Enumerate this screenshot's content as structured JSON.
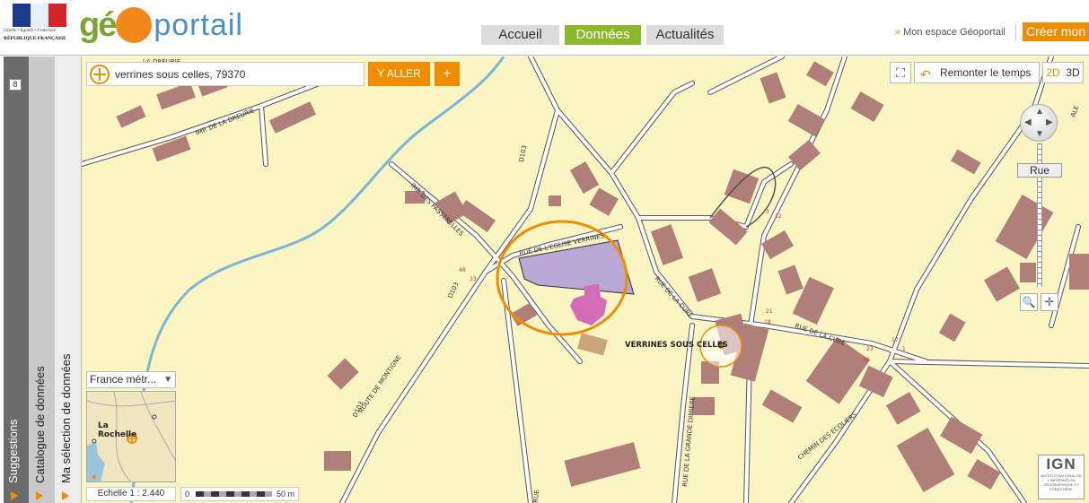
{
  "header": {
    "rf_motto": "Liberté • Égalité • Fraternité",
    "rf_name": "RÉPUBLIQUE FRANÇAISE",
    "logo_ge": "gé",
    "logo_portail": "portail",
    "nav_tabs": [
      {
        "label": "Accueil",
        "active": false
      },
      {
        "label": "Données",
        "active": true
      },
      {
        "label": "Actualités",
        "active": false
      }
    ],
    "espace_label": "Mon espace Géoportail",
    "creer_label": "Créer mon espace",
    "colors": {
      "accent_orange": "#f08c00",
      "active_green": "#8bb92b",
      "brand_blue": "#4a8fc8"
    }
  },
  "side_panels": {
    "count": "8",
    "suggestions": "Suggestions",
    "catalogue": "Catalogue de données",
    "selection": "Ma sélection de données"
  },
  "search": {
    "value": "verrines sous celles, 79370",
    "go_label": "Y ALLER",
    "add_label": "+"
  },
  "tools": {
    "remonter_label": "Remonter le temps",
    "btn_2d": "2D",
    "btn_3d": "3D",
    "zoom_level_label": "Rue"
  },
  "map_labels": {
    "imp_dreurie": "IMP. DE LA DREURIE",
    "imp_passerelles": "IMP. DES PASSERELLES",
    "rue_eglise": "RUE DE L'EGLISE VERRINES",
    "rue_cure_1": "RUE DE LA CURE",
    "rue_cure_2": "RUE DE LA CURE",
    "route_montigne": "ROUTE DE MONTIGNE",
    "rue_grande_dimiere": "RUE DE LA GRANDE DIMIERE",
    "chemin_ecoliers": "CHEMIN DES ECOLIERS",
    "d103_a": "D103",
    "d103_b": "D103",
    "d103_c": "D103",
    "place": "VERRINES SOUS CELLES",
    "la_dreurie_top": "LA DREURIE",
    "rue_partial": "RUE",
    "ale_partial": "ALE",
    "n48": "48",
    "n33": "33",
    "n3": "3",
    "n12": "12",
    "n21": "21",
    "n18": "18",
    "n23": "23",
    "n20": "20",
    "n17": "17",
    "n1": "1"
  },
  "overview": {
    "select_label": "France métr...",
    "city_label_1": "La",
    "city_label_2": "Rochelle"
  },
  "scale": {
    "text": "Echelle 1 :  2.440",
    "zero": "0",
    "max": "50 m"
  },
  "ign": {
    "text": "IGN",
    "sub": "INSTITUT NATIONAL DE L'INFORMATION GÉOGRAPHIQUE ET FORESTIÈRE"
  }
}
